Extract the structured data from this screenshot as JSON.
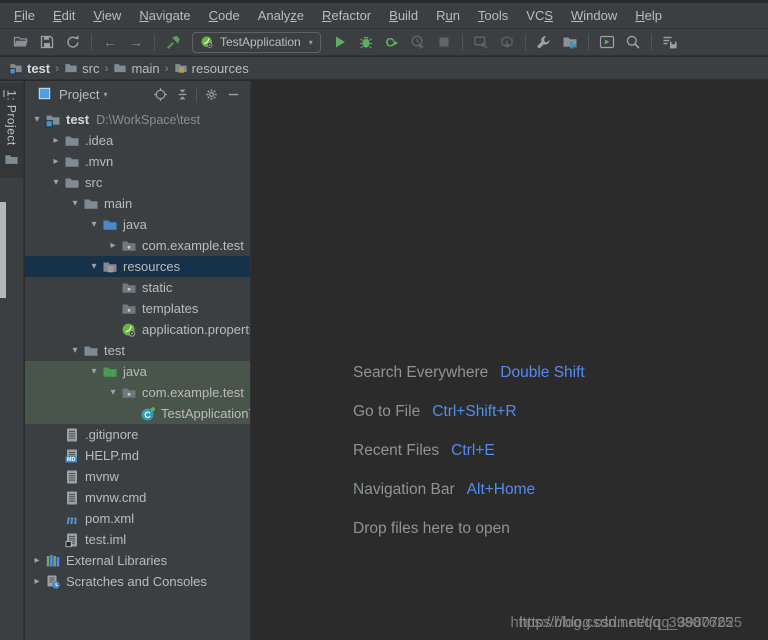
{
  "menu_bar": {
    "items": [
      {
        "label": "File",
        "mnemonic_index": 0
      },
      {
        "label": "Edit",
        "mnemonic_index": 0
      },
      {
        "label": "View",
        "mnemonic_index": 0
      },
      {
        "label": "Navigate",
        "mnemonic_index": 0
      },
      {
        "label": "Code",
        "mnemonic_index": 0
      },
      {
        "label": "Analyze",
        "mnemonic_index": 5
      },
      {
        "label": "Refactor",
        "mnemonic_index": 0
      },
      {
        "label": "Build",
        "mnemonic_index": 0
      },
      {
        "label": "Run",
        "mnemonic_index": 1
      },
      {
        "label": "Tools",
        "mnemonic_index": 0
      },
      {
        "label": "VCS",
        "mnemonic_index": 2
      },
      {
        "label": "Window",
        "mnemonic_index": 0
      },
      {
        "label": "Help",
        "mnemonic_index": 0
      }
    ]
  },
  "toolbar": {
    "run_configuration": {
      "label": "TestApplication"
    },
    "items": [
      {
        "name": "open-project",
        "enabled": true
      },
      {
        "name": "save-all",
        "enabled": true
      },
      {
        "name": "synchronize",
        "enabled": true
      },
      {
        "name": "separator"
      },
      {
        "name": "back",
        "enabled": false
      },
      {
        "name": "forward",
        "enabled": false
      },
      {
        "name": "separator"
      },
      {
        "name": "build-project",
        "enabled": true
      },
      {
        "name": "run-configuration-combo"
      },
      {
        "name": "run",
        "enabled": true
      },
      {
        "name": "debug",
        "enabled": true
      },
      {
        "name": "run-with-coverage",
        "enabled": true
      },
      {
        "name": "profiler",
        "enabled": false
      },
      {
        "name": "stop",
        "enabled": false
      },
      {
        "name": "separator"
      },
      {
        "name": "attach-debugger",
        "enabled": false
      },
      {
        "name": "update-application",
        "enabled": false
      },
      {
        "name": "separator"
      },
      {
        "name": "settings-wrench",
        "enabled": true
      },
      {
        "name": "project-structure",
        "enabled": true
      },
      {
        "name": "separator"
      },
      {
        "name": "run-anything",
        "enabled": true
      },
      {
        "name": "search-everywhere",
        "enabled": true
      },
      {
        "name": "separator"
      },
      {
        "name": "sync-settings",
        "enabled": true
      }
    ]
  },
  "breadcrumbs": {
    "items": [
      {
        "label": "test",
        "icon": "project-folder",
        "bold": true
      },
      {
        "label": "src",
        "icon": "folder",
        "bold": false
      },
      {
        "label": "main",
        "icon": "folder",
        "bold": false
      },
      {
        "label": "resources",
        "icon": "folder-resources",
        "bold": false
      }
    ]
  },
  "tool_window_bar": {
    "project_tab_label": "1: Project"
  },
  "project_panel": {
    "header": {
      "view_label": "Project"
    },
    "tree": [
      {
        "label": "test",
        "suffix": "D:\\WorkSpace\\test",
        "level": 0,
        "state": "expanded",
        "icon": "project-folder",
        "emphasis": "bold",
        "highlight": "none"
      },
      {
        "label": ".idea",
        "level": 1,
        "state": "collapsed",
        "icon": "folder",
        "highlight": "none"
      },
      {
        "label": ".mvn",
        "level": 1,
        "state": "collapsed",
        "icon": "folder",
        "highlight": "none"
      },
      {
        "label": "src",
        "level": 1,
        "state": "expanded",
        "icon": "folder",
        "highlight": "none"
      },
      {
        "label": "main",
        "level": 2,
        "state": "expanded",
        "icon": "folder",
        "highlight": "none"
      },
      {
        "label": "java",
        "level": 3,
        "state": "expanded",
        "icon": "folder-source",
        "highlight": "none"
      },
      {
        "label": "com.example.test",
        "level": 4,
        "state": "collapsed",
        "icon": "package",
        "highlight": "none"
      },
      {
        "label": "resources",
        "level": 3,
        "state": "expanded",
        "icon": "folder-resources",
        "highlight": "selected"
      },
      {
        "label": "static",
        "level": 4,
        "state": "none",
        "icon": "package",
        "highlight": "none"
      },
      {
        "label": "templates",
        "level": 4,
        "state": "none",
        "icon": "package",
        "highlight": "none"
      },
      {
        "label": "application.properti",
        "level": 4,
        "state": "none",
        "icon": "spring-boot",
        "highlight": "none"
      },
      {
        "label": "test",
        "level": 2,
        "state": "expanded",
        "icon": "folder",
        "highlight": "none"
      },
      {
        "label": "java",
        "level": 3,
        "state": "expanded",
        "icon": "folder-test",
        "highlight": "test-scope"
      },
      {
        "label": "com.example.test",
        "level": 4,
        "state": "expanded",
        "icon": "package",
        "highlight": "test-scope"
      },
      {
        "label": "TestApplicationTe",
        "level": 5,
        "state": "none",
        "icon": "class",
        "highlight": "test-scope"
      },
      {
        "label": ".gitignore",
        "level": 1,
        "state": "none",
        "icon": "text-file",
        "highlight": "none"
      },
      {
        "label": "HELP.md",
        "level": 1,
        "state": "none",
        "icon": "markdown-file",
        "highlight": "none"
      },
      {
        "label": "mvnw",
        "level": 1,
        "state": "none",
        "icon": "text-file",
        "highlight": "none"
      },
      {
        "label": "mvnw.cmd",
        "level": 1,
        "state": "none",
        "icon": "text-file",
        "highlight": "none"
      },
      {
        "label": "pom.xml",
        "level": 1,
        "state": "none",
        "icon": "maven-file",
        "highlight": "none"
      },
      {
        "label": "test.iml",
        "level": 1,
        "state": "none",
        "icon": "iml-file",
        "highlight": "none"
      },
      {
        "label": "External Libraries",
        "level": 0,
        "state": "collapsed",
        "icon": "libraries",
        "highlight": "none"
      },
      {
        "label": "Scratches and Consoles",
        "level": 0,
        "state": "collapsed",
        "icon": "scratches",
        "highlight": "none"
      }
    ]
  },
  "editor": {
    "hints": [
      {
        "label": "Search Everywhere",
        "shortcut": "Double Shift"
      },
      {
        "label": "Go to File",
        "shortcut": "Ctrl+Shift+R"
      },
      {
        "label": "Recent Files",
        "shortcut": "Ctrl+E"
      },
      {
        "label": "Navigation Bar",
        "shortcut": "Alt+Home"
      },
      {
        "label": "Drop files here to open",
        "shortcut": ""
      }
    ],
    "watermark": "https://blog.csdn.net/qq_39807625"
  },
  "colors": {
    "panel_bg": "#3c3f41",
    "editor_bg": "#2b2b2b",
    "border": "#323232",
    "text": "#bbbbbb",
    "muted_text": "#8f9296",
    "selection_bg": "#16324a",
    "test_scope_bg": "#49544a",
    "accent_blue": "#548cec",
    "run_green": "#5fad65",
    "spring_green": "#6db33f",
    "resources_yellow": "#d9a343",
    "source_blue": "#4a88c7",
    "test_green": "#499c54"
  }
}
